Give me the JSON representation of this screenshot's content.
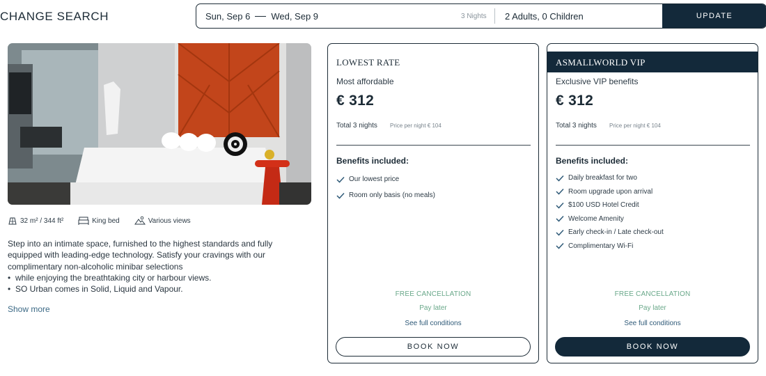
{
  "header": {
    "title": "CHANGE SEARCH",
    "check_in": "Sun, Sep 6",
    "check_out": "Wed, Sep 9",
    "nights": "3 Nights",
    "guests": "2 Adults, 0 Children",
    "update_label": "UPDATE"
  },
  "room": {
    "features": [
      {
        "icon": "room-size-icon",
        "label": "32 m² / 344 ft²"
      },
      {
        "icon": "bed-icon",
        "label": "King bed"
      },
      {
        "icon": "view-icon",
        "label": "Various views"
      }
    ],
    "description": "Step into an intimate space, furnished to the highest standards and fully equipped with leading-edge technology. Satisfy your cravings with our complimentary non-alcoholic minibar selections",
    "bullets": [
      "while enjoying the breathtaking city or harbour views.",
      "SO Urban comes in Solid, Liquid and Vapour."
    ],
    "show_more": "Show more"
  },
  "rates": [
    {
      "title": "LOWEST RATE",
      "subtitle": "Most affordable",
      "price": "€ 312",
      "total": "Total 3 nights",
      "per_night": "Price per night € 104",
      "benefits_heading": "Benefits included:",
      "benefits": [
        "Our lowest price",
        "Room only basis (no meals)"
      ],
      "free_cancellation": "FREE CANCELLATION",
      "pay_later": "Pay later",
      "conditions": "See full conditions",
      "book_label": "BOOK NOW"
    },
    {
      "title": "ASMALLWORLD VIP",
      "subtitle": "Exclusive VIP benefits",
      "price": "€ 312",
      "total": "Total 3 nights",
      "per_night": "Price per night € 104",
      "benefits_heading": "Benefits included:",
      "benefits": [
        "Daily breakfast for two",
        "Room upgrade upon arrival",
        "$100 USD Hotel Credit",
        "Welcome Amenity",
        "Early check-in / Late check-out",
        "Complimentary Wi-Fi"
      ],
      "free_cancellation": "FREE CANCELLATION",
      "pay_later": "Pay later",
      "conditions": "See full conditions",
      "book_label": "BOOK NOW"
    }
  ],
  "colors": {
    "navy": "#13293a",
    "text": "#1c2b36",
    "green": "#6aa88a",
    "link": "#3d6a86",
    "headboard": "#c2451b"
  }
}
